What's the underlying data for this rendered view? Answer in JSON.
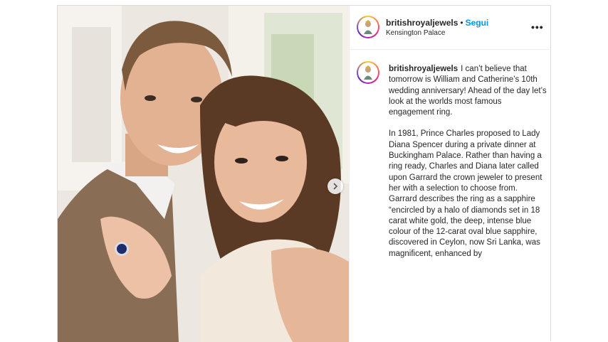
{
  "post": {
    "username": "britishroyaljewels",
    "follow_label": "Segui",
    "separator": "•",
    "location": "Kensington Palace",
    "more_label": "•••",
    "caption_paragraph_1": "I can’t believe that tomorrow is William and Catherine’s 10th wedding anniversary! Ahead of the day let’s look at the worlds most famous engagement ring.",
    "caption_paragraph_2": "In 1981, Prince Charles proposed to Lady Diana Spencer during a private dinner at Buckingham Palace. Rather than having a ring ready, Charles and Diana later called upon Garrard the crown jeweler to present her with a selection to choose from. Garrard describes the ring as a sapphire “encircled by a halo of diamonds set in 18 carat white gold, the deep, intense blue colour of the 12-carat oval blue sapphire, discovered in Ceylon, now Sri Lanka, was magnificent, enhanced by"
  },
  "media": {
    "next_icon": "chevron-right-icon",
    "photo_icon": "couple-photo"
  },
  "colors": {
    "link_blue": "#0095f6",
    "text": "#262626",
    "border": "#dbdbdb"
  }
}
